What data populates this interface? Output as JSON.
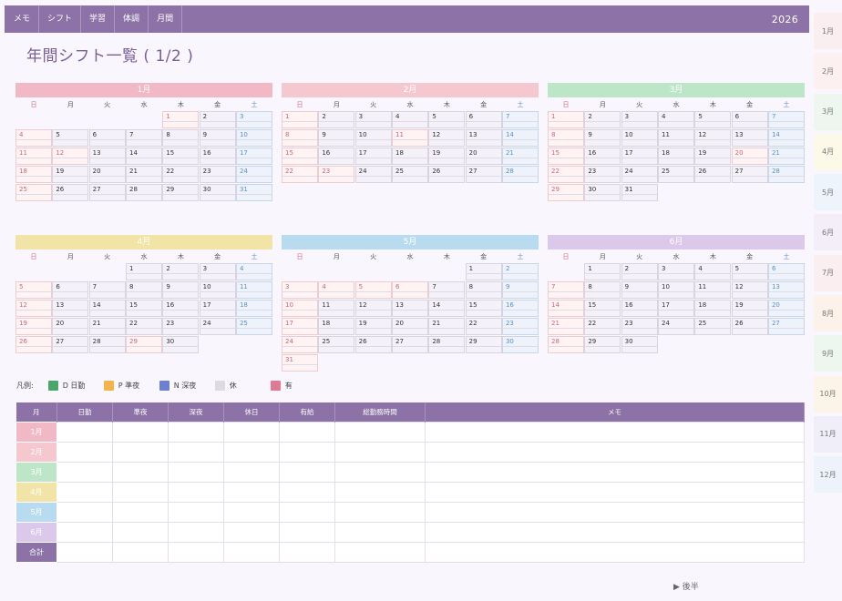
{
  "nav": {
    "tabs": [
      {
        "label": "メモ"
      },
      {
        "label": "シフト"
      },
      {
        "label": "学習"
      },
      {
        "label": "体調"
      },
      {
        "label": "月間"
      }
    ],
    "year": "2026"
  },
  "page_title": "年間シフト一覧 ( 1/2 )",
  "side_tabs": [
    {
      "label": "1月",
      "color": "#fbeef0"
    },
    {
      "label": "2月",
      "color": "#fdf0f0"
    },
    {
      "label": "3月",
      "color": "#edf7ef"
    },
    {
      "label": "4月",
      "color": "#fcf9e8"
    },
    {
      "label": "5月",
      "color": "#edf4fb"
    },
    {
      "label": "6月",
      "color": "#f4eef9"
    },
    {
      "label": "7月",
      "color": "#fbeef0"
    },
    {
      "label": "8月",
      "color": "#fcf2ea"
    },
    {
      "label": "9月",
      "color": "#edf7ef"
    },
    {
      "label": "10月",
      "color": "#fcf4e8"
    },
    {
      "label": "11月",
      "color": "#f0eef9"
    },
    {
      "label": "12月",
      "color": "#edf2fb"
    }
  ],
  "weekdays": [
    "日",
    "月",
    "火",
    "水",
    "木",
    "金",
    "土"
  ],
  "months": [
    {
      "label": "1月",
      "color": "#f1b9c6",
      "start": 4,
      "days": 31,
      "holidays": [
        1,
        12
      ]
    },
    {
      "label": "2月",
      "color": "#f5c8d0",
      "start": 0,
      "days": 28,
      "holidays": [
        11,
        23
      ]
    },
    {
      "label": "3月",
      "color": "#bde6c9",
      "start": 0,
      "days": 31,
      "holidays": [
        20
      ]
    },
    {
      "label": "4月",
      "color": "#f2e3a6",
      "start": 3,
      "days": 30,
      "holidays": [
        29
      ]
    },
    {
      "label": "5月",
      "color": "#b9dbf0",
      "start": 5,
      "days": 31,
      "holidays": [
        3,
        4,
        5,
        6
      ]
    },
    {
      "label": "6月",
      "color": "#dcc8ea",
      "start": 1,
      "days": 30,
      "holidays": []
    }
  ],
  "legend": {
    "title": "凡例:",
    "items": [
      {
        "label": "D 日勤",
        "color": "#4aa66b"
      },
      {
        "label": "P 準夜",
        "color": "#f2b54b"
      },
      {
        "label": "N 深夜",
        "color": "#6c7fd1"
      },
      {
        "label": "休",
        "color": "#dcdbe0"
      },
      {
        "label": "有",
        "color": "#e07a92"
      }
    ]
  },
  "summary": {
    "headers": [
      "月",
      "日勤",
      "準夜",
      "深夜",
      "休日",
      "有給",
      "総勤務時間",
      "メモ"
    ],
    "rows": [
      {
        "label": "1月",
        "color": "#f1b9c6"
      },
      {
        "label": "2月",
        "color": "#f5c8d0"
      },
      {
        "label": "3月",
        "color": "#bde6c9"
      },
      {
        "label": "4月",
        "color": "#f2e3a6"
      },
      {
        "label": "5月",
        "color": "#b9dbf0"
      },
      {
        "label": "6月",
        "color": "#dcc8ea"
      }
    ],
    "total_label": "合計",
    "total_color": "#8c72a6"
  },
  "next_label": "▶ 後半"
}
